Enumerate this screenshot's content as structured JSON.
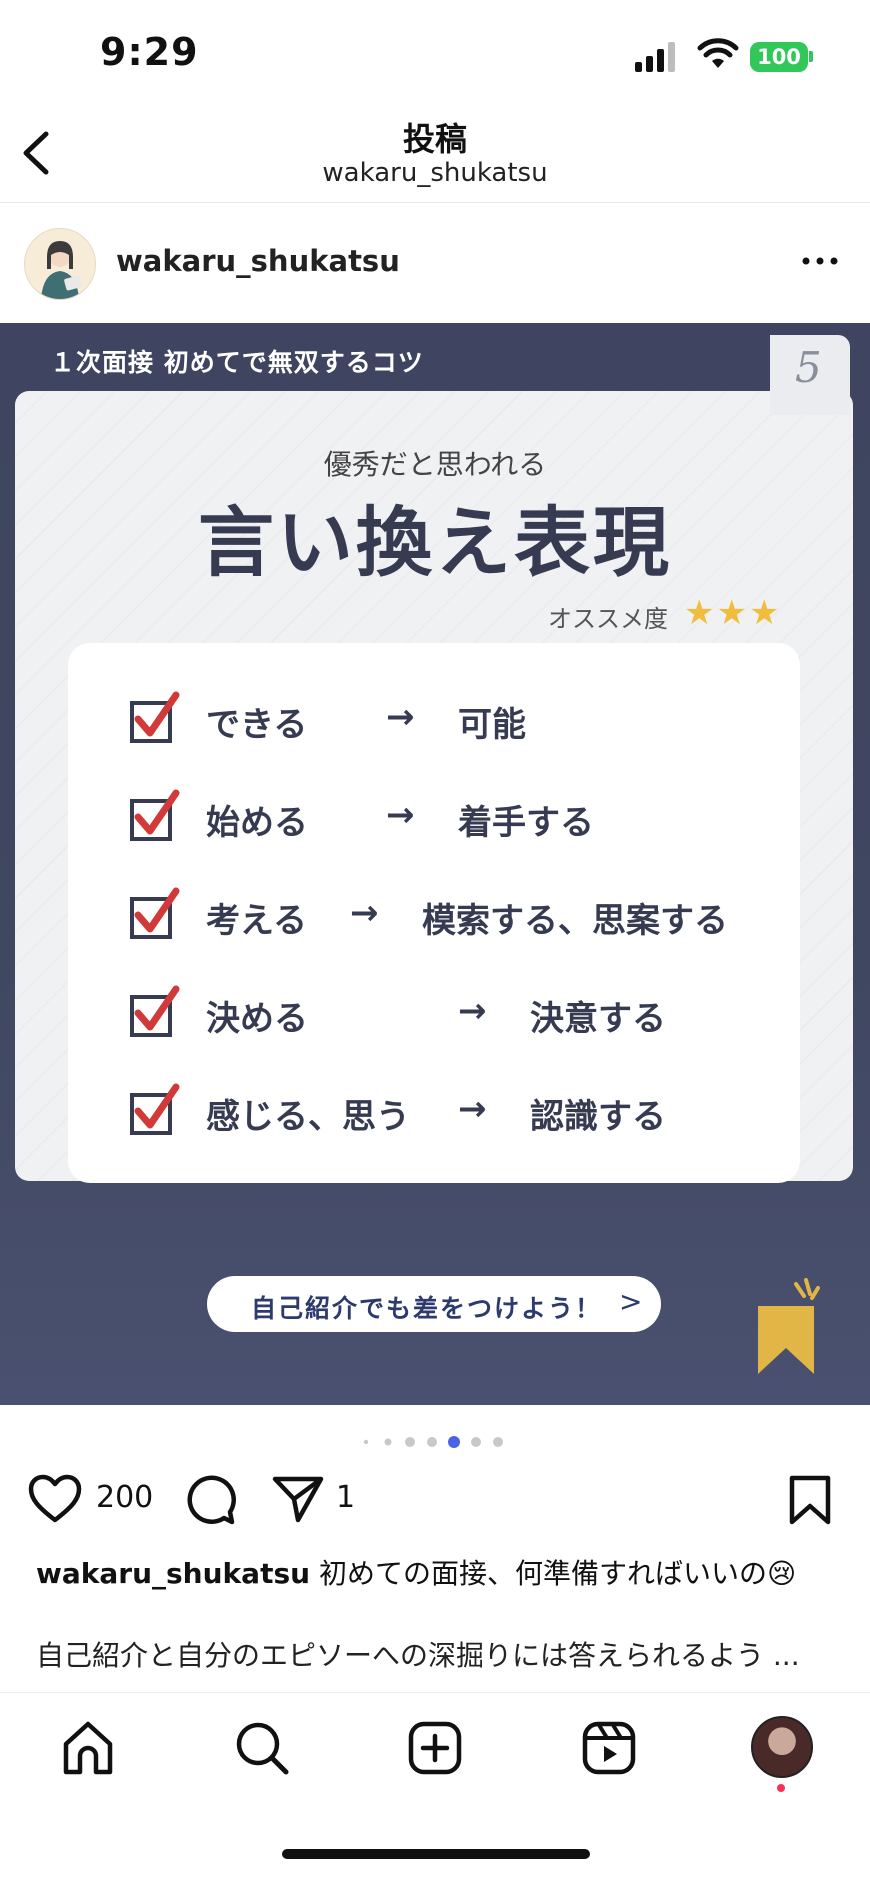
{
  "status_bar": {
    "time": "9:29",
    "battery": "100"
  },
  "header": {
    "title": "投稿",
    "subtitle": "wakaru_shukatsu"
  },
  "profile": {
    "username": "wakaru_shukatsu"
  },
  "post": {
    "banner": "１次面接 初めてで無双するコツ",
    "page_number": "5",
    "subtitle": "優秀だと思われる",
    "title": "言い換え表現",
    "recommend_label": "オススメ度",
    "stars": "★★★",
    "items": [
      {
        "from": "できる",
        "arrow": "→",
        "to": "可能"
      },
      {
        "from": "始める",
        "arrow": "→",
        "to": "着手する"
      },
      {
        "from": "考える",
        "arrow": "→",
        "to": "模索する、思案する"
      },
      {
        "from": "決める",
        "arrow": "→",
        "to": "決意する"
      },
      {
        "from": "感じる、思う",
        "arrow": "→",
        "to": "認識する"
      }
    ],
    "cta_label": "自己紹介でも差をつけよう！",
    "cta_arrow": ">"
  },
  "carousel": {
    "total_dots": 7,
    "active_index": 4
  },
  "actions": {
    "like_count": "200",
    "share_count": "1"
  },
  "caption": {
    "username": "wakaru_shukatsu",
    "text": " 初めての面接、何準備すればいいの😢",
    "second_line": "自己紹介と自分のエピソーへの深掘りには答えられるよう ..."
  },
  "colors": {
    "post_bg": "#404761",
    "accent": "#363b52",
    "check_red": "#d23a3a",
    "star": "#f0bd3e",
    "active_dot": "#4a63e6"
  }
}
